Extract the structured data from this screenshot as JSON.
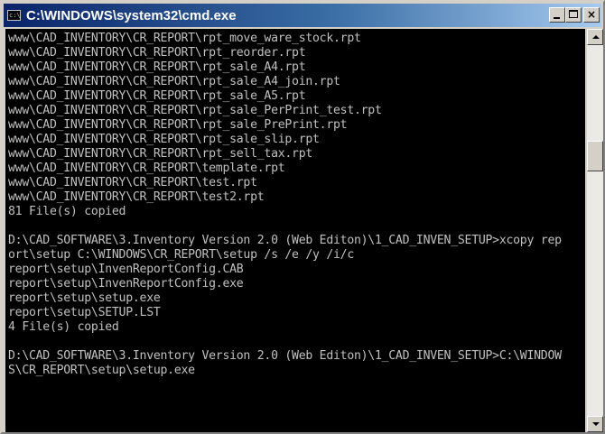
{
  "window": {
    "title": "C:\\WINDOWS\\system32\\cmd.exe",
    "icon": "cmd-console-icon",
    "icon_glyph": "c:\\",
    "buttons": {
      "minimize": "minimize-icon",
      "maximize": "maximize-icon",
      "close_glyph": "×"
    }
  },
  "console": {
    "text_color": "#c0c0c0",
    "background": "#000000",
    "lines": [
      "www\\CAD_INVENTORY\\CR_REPORT\\rpt_move_ware_stock.rpt",
      "www\\CAD_INVENTORY\\CR_REPORT\\rpt_reorder.rpt",
      "www\\CAD_INVENTORY\\CR_REPORT\\rpt_sale_A4.rpt",
      "www\\CAD_INVENTORY\\CR_REPORT\\rpt_sale_A4_join.rpt",
      "www\\CAD_INVENTORY\\CR_REPORT\\rpt_sale_A5.rpt",
      "www\\CAD_INVENTORY\\CR_REPORT\\rpt_sale_PerPrint_test.rpt",
      "www\\CAD_INVENTORY\\CR_REPORT\\rpt_sale_PrePrint.rpt",
      "www\\CAD_INVENTORY\\CR_REPORT\\rpt_sale_slip.rpt",
      "www\\CAD_INVENTORY\\CR_REPORT\\rpt_sell_tax.rpt",
      "www\\CAD_INVENTORY\\CR_REPORT\\template.rpt",
      "www\\CAD_INVENTORY\\CR_REPORT\\test.rpt",
      "www\\CAD_INVENTORY\\CR_REPORT\\test2.rpt",
      "81 File(s) copied",
      "",
      "D:\\CAD_SOFTWARE\\3.Inventory Version 2.0 (Web Editon)\\1_CAD_INVEN_SETUP>xcopy rep",
      "ort\\setup C:\\WINDOWS\\CR_REPORT\\setup /s /e /y /i/c",
      "report\\setup\\InvenReportConfig.CAB",
      "report\\setup\\InvenReportConfig.exe",
      "report\\setup\\setup.exe",
      "report\\setup\\SETUP.LST",
      "4 File(s) copied",
      "",
      "D:\\CAD_SOFTWARE\\3.Inventory Version 2.0 (Web Editon)\\1_CAD_INVEN_SETUP>C:\\WINDOW",
      "S\\CR_REPORT\\setup\\setup.exe"
    ]
  },
  "scrollbar": {
    "up_icon": "scroll-up-arrow-icon",
    "down_icon": "scroll-down-arrow-icon"
  }
}
